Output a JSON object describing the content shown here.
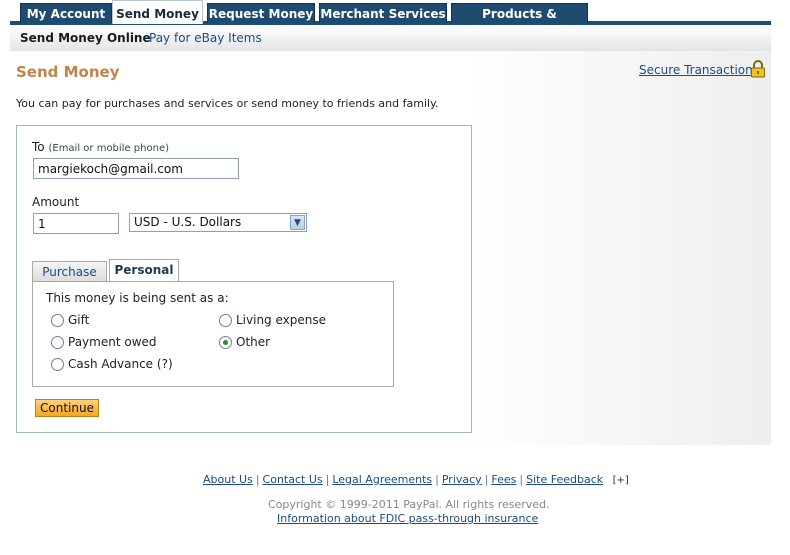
{
  "topnav": {
    "tabs": [
      {
        "label": "My Account"
      },
      {
        "label": "Send Money"
      },
      {
        "label": "Request Money"
      },
      {
        "label": "Merchant Services"
      },
      {
        "label": "Products & Services"
      }
    ]
  },
  "subnav": {
    "items": [
      {
        "label": "Send Money Online"
      },
      {
        "label": "Pay for eBay Items"
      }
    ]
  },
  "page": {
    "title": "Send Money",
    "secure_link": "Secure Transaction",
    "intro": "You can pay for purchases and services or send money to friends and family."
  },
  "form": {
    "to_label": "To",
    "to_hint": "(Email or mobile phone)",
    "to_value": "margiekoch@gmail.com",
    "amount_label": "Amount",
    "amount_value": "1",
    "currency_selected": "USD - U.S. Dollars",
    "tabs": [
      {
        "label": "Purchase"
      },
      {
        "label": "Personal"
      }
    ],
    "sent_as_label": "This money is being sent as a:",
    "options": [
      {
        "label": "Gift",
        "checked": false
      },
      {
        "label": "Living expense",
        "checked": false
      },
      {
        "label": "Payment owed",
        "checked": false
      },
      {
        "label": "Other",
        "checked": true
      },
      {
        "label": "Cash Advance",
        "checked": false
      }
    ],
    "help_marker": "(?)",
    "continue_label": "Continue"
  },
  "footer": {
    "links": [
      "About Us",
      "Contact Us",
      "Legal Agreements",
      "Privacy",
      "Fees",
      "Site Feedback"
    ],
    "feedback_marker": "[+]",
    "copyright": "Copyright © 1999-2011 PayPal. All rights reserved.",
    "fdic": "Information about FDIC pass-through insurance"
  },
  "colors": {
    "nav_tab": "#1e4b6f",
    "title_accent": "#c0834a",
    "link": "#1a4c86",
    "button": "#f4a623",
    "radio_checked": "#2b8c2b"
  }
}
